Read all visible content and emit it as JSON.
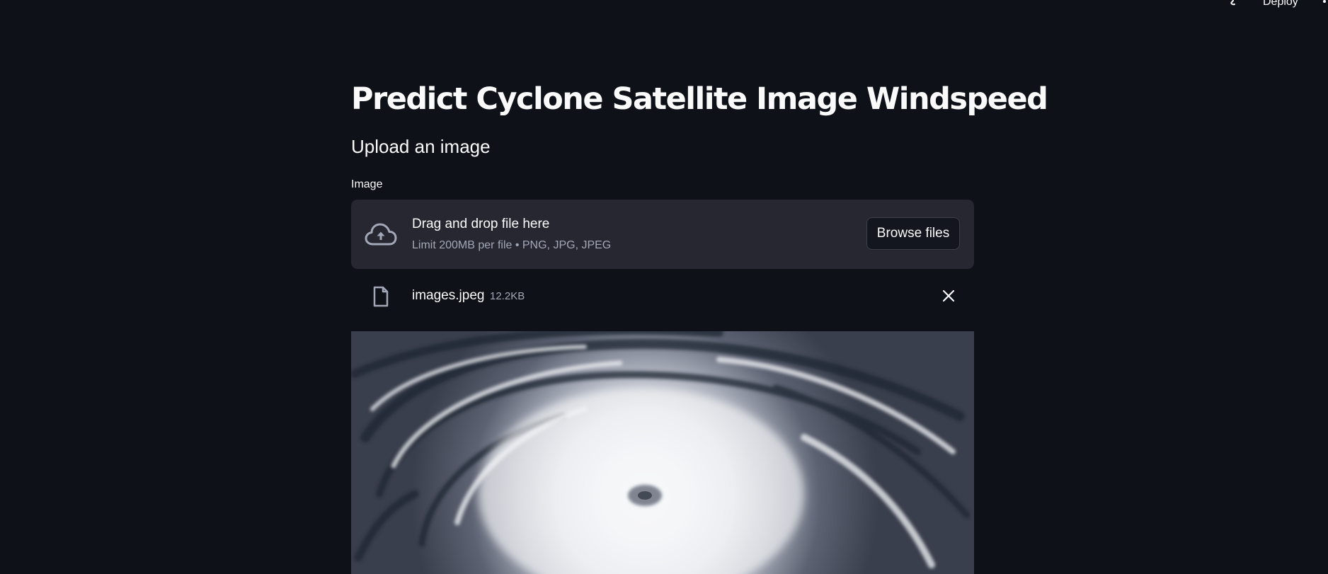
{
  "topbar": {
    "deploy_label": "Deploy",
    "status_icon": "running-status-icon",
    "menu_icon": "vertical-dots-icon"
  },
  "page": {
    "title": "Predict Cyclone Satellite Image Windspeed",
    "subtitle": "Upload an image"
  },
  "uploader": {
    "label": "Image",
    "drop_title": "Drag and drop file here",
    "limit_text": "Limit 200MB per file • PNG, JPG, JPEG",
    "browse_label": "Browse files",
    "upload_icon": "cloud-upload-icon"
  },
  "uploaded_file": {
    "name": "images.jpeg",
    "size": "12.2KB",
    "file_icon": "file-icon",
    "remove_icon": "close-icon"
  },
  "preview": {
    "subject": "cyclone-satellite-image"
  },
  "colors": {
    "background": "#0e1117",
    "dropzone": "#262730",
    "text": "#fafafa",
    "muted_text": "#a3a8b8"
  }
}
